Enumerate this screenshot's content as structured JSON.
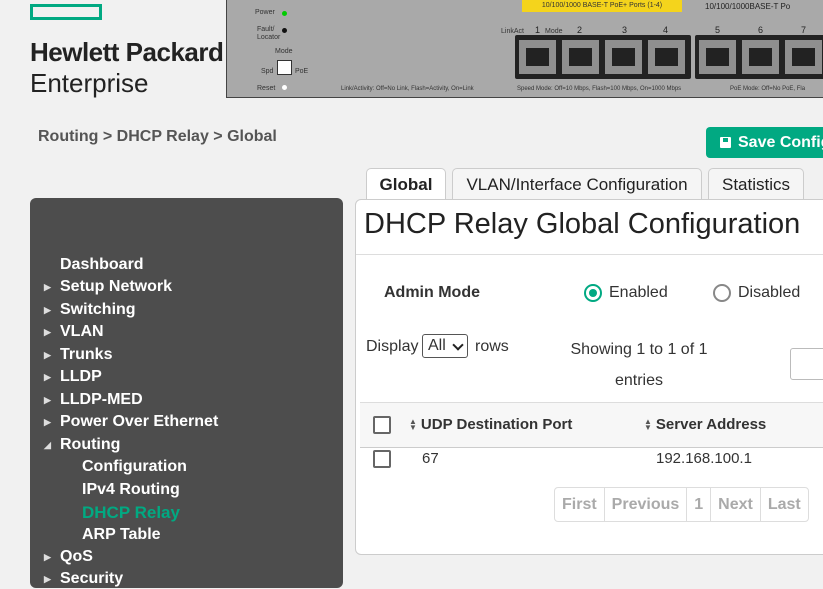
{
  "brand": {
    "line1": "Hewlett Packard",
    "line2": "Enterprise",
    "accent": "#01a982"
  },
  "switch_panel": {
    "labels": {
      "power": "Power",
      "fault": "Fault/",
      "locator": "Locator",
      "mode": "Mode",
      "spd": "Spd",
      "poe": "PoE",
      "reset": "Reset",
      "link_act": "LinkAct",
      "mode_small": "Mode"
    },
    "poe_ports_header": "10/100/1000 BASE-T PoE+ Ports (1-4)",
    "ports_header": "10/100/1000BASE-T Po",
    "ports": [
      "1",
      "2",
      "3",
      "4",
      "5",
      "6",
      "7"
    ],
    "legend_link": "Link/Activity: Off=No Link, Flash=Activity, On=Link",
    "legend_speed": "Speed Mode: Off=10 Mbps, Flash=100 Mbps, On=1000 Mbps",
    "legend_poe": "PoE Mode: Off=No PoE, Fla"
  },
  "breadcrumb": "Routing > DHCP Relay > Global",
  "save_label": "Save Config",
  "sidebar": {
    "items": [
      {
        "label": "Dashboard",
        "arrow": ""
      },
      {
        "label": "Setup Network",
        "arrow": "▶"
      },
      {
        "label": "Switching",
        "arrow": "▶"
      },
      {
        "label": "VLAN",
        "arrow": "▶"
      },
      {
        "label": "Trunks",
        "arrow": "▶"
      },
      {
        "label": "LLDP",
        "arrow": "▶"
      },
      {
        "label": "LLDP-MED",
        "arrow": "▶"
      },
      {
        "label": "Power Over Ethernet",
        "arrow": "▶"
      },
      {
        "label": "Routing",
        "arrow": "◢"
      }
    ],
    "routing_sub": [
      {
        "label": "Configuration"
      },
      {
        "label": "IPv4 Routing"
      },
      {
        "label": "DHCP Relay"
      },
      {
        "label": "ARP Table"
      }
    ],
    "after": [
      {
        "label": "QoS",
        "arrow": "▶"
      },
      {
        "label": "Security",
        "arrow": "▶"
      }
    ]
  },
  "tabs": [
    {
      "label": "Global"
    },
    {
      "label": "VLAN/Interface Configuration"
    },
    {
      "label": "Statistics"
    }
  ],
  "panel": {
    "title": "DHCP Relay Global Configuration",
    "admin_mode_label": "Admin Mode",
    "enabled_label": "Enabled",
    "disabled_label": "Disabled",
    "display_label": "Display",
    "display_value": "All",
    "rows_label": "rows",
    "showing": "Showing 1 to 1 of 1 entries",
    "columns": [
      "UDP Destination Port",
      "Server Address"
    ],
    "rows": [
      {
        "port": "67",
        "server": "192.168.100.1"
      }
    ],
    "pager": [
      "First",
      "Previous",
      "1",
      "Next",
      "Last"
    ]
  }
}
